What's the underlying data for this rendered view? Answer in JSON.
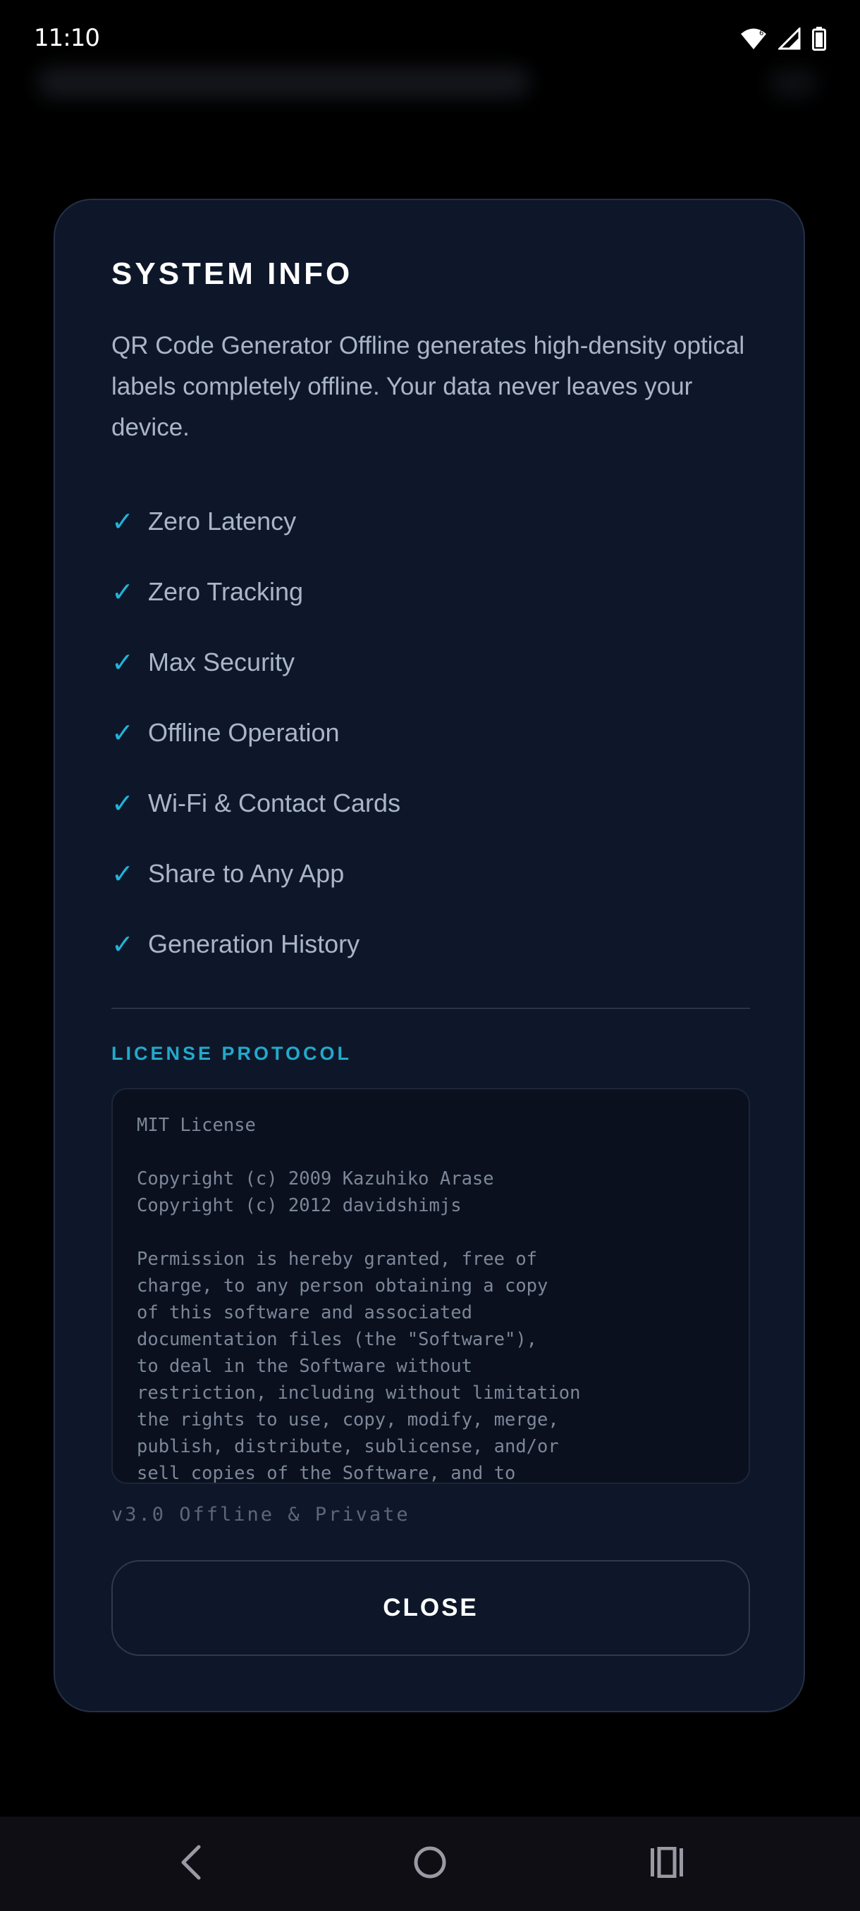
{
  "status_bar": {
    "time": "11:10",
    "icons": [
      "wifi-icon",
      "signal-icon",
      "battery-icon"
    ]
  },
  "dialog": {
    "title": "SYSTEM INFO",
    "description": "QR Code Generator Offline generates high-density optical labels completely offline. Your data never leaves your device.",
    "check_glyph": "✓",
    "features": [
      "Zero Latency",
      "Zero Tracking",
      "Max Security",
      "Offline Operation",
      "Wi-Fi & Contact Cards",
      "Share to Any App",
      "Generation History"
    ],
    "license_heading": "LICENSE PROTOCOL",
    "license_text": "MIT License\n\nCopyright (c) 2009 Kazuhiko Arase\nCopyright (c) 2012 davidshimjs\n\nPermission is hereby granted, free of\ncharge, to any person obtaining a copy\nof this software and associated\ndocumentation files (the \"Software\"),\nto deal in the Software without\nrestriction, including without limitation\nthe rights to use, copy, modify, merge,\npublish, distribute, sublicense, and/or\nsell copies of the Software, and to",
    "version": "v3.0 Offline & Private",
    "close_label": "CLOSE"
  },
  "colors": {
    "dialog_bg": "#0e1729",
    "accent": "#22b3d8",
    "text": "#a9b6c8",
    "title": "#ffffff"
  },
  "navigation": {
    "icons": [
      "back-icon",
      "home-icon",
      "recents-icon"
    ]
  }
}
